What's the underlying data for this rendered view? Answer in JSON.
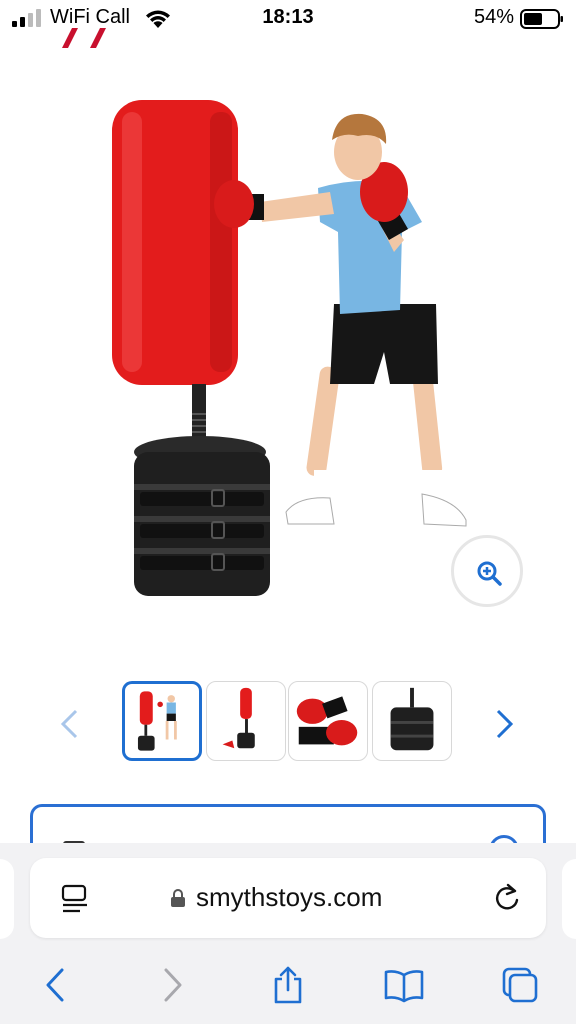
{
  "status_bar": {
    "carrier": "WiFi Call",
    "time": "18:13",
    "battery_percent": "54%"
  },
  "product": {
    "image": "free-standing-punch-bag-with-boy",
    "zoom_icon": "zoom-in-icon",
    "thumbnails": [
      {
        "name": "punch-bag-with-boy",
        "selected": true
      },
      {
        "name": "punch-bag-standing",
        "selected": false
      },
      {
        "name": "boxing-gloves",
        "selected": false
      },
      {
        "name": "punch-bag-base",
        "selected": false
      }
    ]
  },
  "browser": {
    "url": "smythstoys.com",
    "reader_icon": "reader-mode-icon",
    "lock_icon": "lock-icon",
    "reload_icon": "reload-icon"
  },
  "colors": {
    "accent": "#1f6fd1",
    "bag_red": "#e31c1c",
    "toolbar_bg": "#f2f2f4"
  }
}
